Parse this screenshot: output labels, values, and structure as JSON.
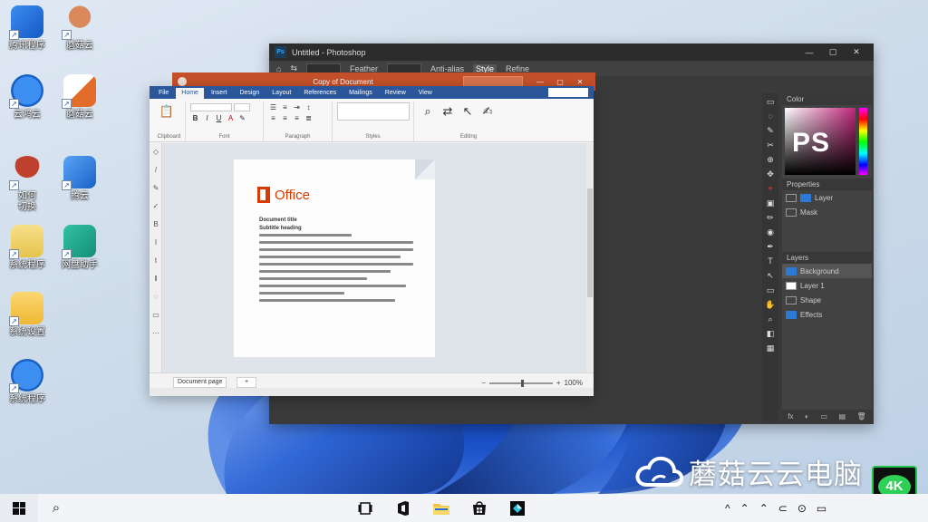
{
  "desktop": {
    "icons": [
      {
        "label": "腾讯程序",
        "color": "#2e7be0"
      },
      {
        "label": "蘑菇云",
        "color": "#b86b3a"
      },
      {
        "label": "云鸿云",
        "color": "#1f78d6"
      },
      {
        "label": "蘑菇云",
        "color": "#e26c2a"
      },
      {
        "label": "如何\n切换",
        "color": "#b03a2a"
      },
      {
        "label": "腾云",
        "color": "#2f8ad8"
      },
      {
        "label": "系统程序",
        "color": "#e6c44b"
      },
      {
        "label": "网盘助手",
        "color": "#21a38a"
      },
      {
        "label": "系统设置",
        "color": "#f0c041"
      },
      {
        "label": "系统程序",
        "color": "#2778d0"
      }
    ]
  },
  "photoshop": {
    "title": "Untitled - Photoshop",
    "window_controls": [
      "—",
      "▢",
      "✕"
    ],
    "options_bar": [
      "⌂",
      "⇆",
      "Feather",
      "Anti-alias",
      "Style",
      "Refine"
    ],
    "tools": [
      "▭",
      "◌",
      "✎",
      "✂",
      "⊕",
      "✥",
      "⌖",
      "▣",
      "✏",
      "◉",
      "✒",
      "T",
      "↖",
      "▭",
      "✋",
      "⌕",
      "◧",
      "▦"
    ],
    "color_panel_title": "Color",
    "ps_text": "PS",
    "properties_title": "Properties",
    "properties_rows": [
      "Layer",
      "Mask"
    ],
    "layers_title": "Layers",
    "layers": [
      "Background",
      "Layer 1",
      "Shape",
      "Effects"
    ],
    "layers_footer": [
      "fx",
      "◐",
      "▭",
      "▤",
      "🗑"
    ],
    "accent": "#31a8ff"
  },
  "ppt": {
    "title": "Copy of Document",
    "window_controls": [
      "—",
      "▢",
      "✕"
    ],
    "accent": "#c4502a"
  },
  "word": {
    "tabs": [
      "File",
      "Home",
      "Insert",
      "Design",
      "Layout",
      "References",
      "Mailings",
      "Review",
      "View"
    ],
    "ribbon_groups": [
      "Clipboard",
      "Font",
      "Paragraph",
      "Styles",
      "Editing"
    ],
    "font_name": "Calibri",
    "font_size": "11",
    "office_word": "Office",
    "doc_heading": "Document title",
    "doc_subheading": "Subtitle heading",
    "sheet_tab": "Document page",
    "sheet_tab2": "+",
    "zoom": "100%",
    "accent": "#2b579a"
  },
  "watermark": {
    "text": "蘑菇云云电脑",
    "badge": "4K"
  },
  "taskbar": {
    "apps": [
      "task-view",
      "office",
      "files",
      "store",
      "photoshop"
    ],
    "tray": [
      "^",
      "⌃",
      "⌃",
      "⊂",
      "⊙",
      "▭"
    ]
  }
}
